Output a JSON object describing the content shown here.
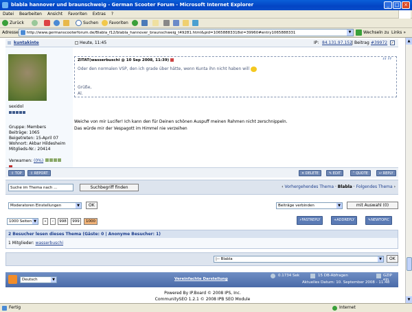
{
  "window": {
    "title": "blabla hannover und braunschweig - German Scooter Forum - Microsoft Internet Explorer"
  },
  "menu": [
    "Datei",
    "Bearbeiten",
    "Ansicht",
    "Favoriten",
    "Extras",
    "?"
  ],
  "toolbar": {
    "back": "Zurück",
    "search": "Suchen",
    "favorites": "Favoriten"
  },
  "address": {
    "label": "Adresse",
    "url": "http://www.germanscooterforum.de/Blabla_f12/blabla_hannover_braunschweig_t49281.html&pid=10658883318st=39960#entry1065888331",
    "go": "Wechseln zu",
    "links": "Links"
  },
  "post": {
    "author": "kuntakinte",
    "date": "Heute, 11:45",
    "ip_label": "IP:",
    "ip": "84.131.97.152",
    "entry_label": "Beitrag",
    "entry": "#39972",
    "rank": "sexidol",
    "info": [
      "Gruppe: Members",
      "Beiträge: 1065",
      "Beigetreten: 15-April 07",
      "Wohnort: Akbar Hildesheim",
      "Mitglieds-Nr.: 20414"
    ],
    "warn_label": "Verwarnen:",
    "warn_value": "(0%)",
    "quote_head": "ZITAT(wasserbuschi @ 10 Sep 2008, 11:39)",
    "quote_text": "Oder den normalen VSP, den ich grade über hätte, wenn Kunta ihn nicht haben will",
    "quote_sign1": "Grüße,",
    "quote_sign2": "Al.",
    "body1": "Weiche von mir Lucifer! Ich kann den für Deinen schönen Auspuff meinen Rahmen nicht zerschnippeln.",
    "body2": "Das würde mir der Vespagott im Himmel nie verzeihen",
    "btn_top": "TOP",
    "btn_report": "REPORT",
    "btn_delete": "DELETE",
    "btn_edit": "EDIT",
    "btn_quote": "QUOTE",
    "btn_reply": "REPLY"
  },
  "search": {
    "placeholder": "Suche im Thema nach ...",
    "button": "Suchbegriff finden"
  },
  "topicnav": {
    "prev": "Vorhergehendes Thema",
    "current": "Blabla",
    "next": "Folgendes Thema"
  },
  "mod": {
    "select": "Moderatoren Einstellungen",
    "ok": "OK",
    "merge": "Beiträge verbinden",
    "selected": "mit Auswahl (0)"
  },
  "pages": {
    "select": "1000 Seiten",
    "p1": "998",
    "p2": "999",
    "p3": "1000"
  },
  "actions": {
    "fastreply": "FASTREPLY",
    "addreply": "ADDREPLY",
    "newtopic": "NEWTOPIC"
  },
  "online": {
    "head": "2 Besucher lesen dieses Thema (Gäste: 0 | Anonyme Besucher: 1)",
    "members_label": "1 Mitglieder:",
    "member": "wasserbuschi"
  },
  "jump": {
    "select": "|-- Blabla",
    "ok": "OK"
  },
  "footer": {
    "lang": "Deutsch",
    "simple": "Vereinfachte Darstellung",
    "time": "0.1734 Sek",
    "queries": "15 DB-Abfragen",
    "gzip": "GZIP ein",
    "date": "Aktuelles Datum: 10. September 2008 - 11:48",
    "powered": "Powered By IP.Board © 2008  IPS, Inc.",
    "seo": "CommunitySEO 1.2.1 © 2008  IPB SEO Module"
  },
  "status": {
    "done": "Fertig",
    "zone": "Internet"
  }
}
